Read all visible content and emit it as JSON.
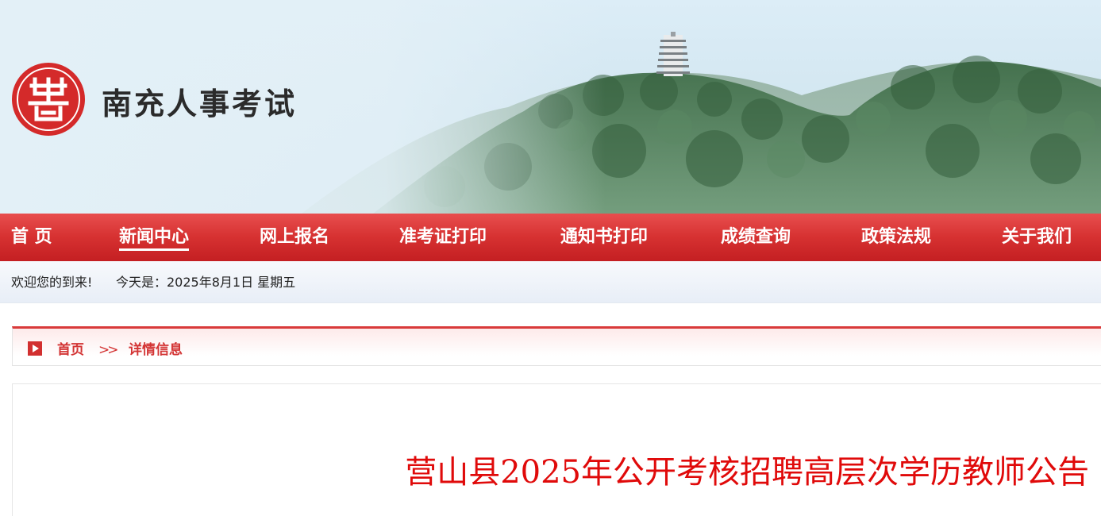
{
  "header": {
    "site_title": "南充人事考试",
    "logo_icon": "seal-logo-icon",
    "brand_color": "#d42a2a"
  },
  "nav": {
    "items": [
      {
        "label": "首 页"
      },
      {
        "label": "新闻中心",
        "active": true
      },
      {
        "label": "网上报名"
      },
      {
        "label": "准考证打印"
      },
      {
        "label": "通知书打印"
      },
      {
        "label": "成绩查询"
      },
      {
        "label": "政策法规"
      },
      {
        "label": "关于我们"
      }
    ]
  },
  "welcome": {
    "greeting": "欢迎您的到来!",
    "today": "今天是：2025年8月1日 星期五"
  },
  "breadcrumb": {
    "icon": "play-arrow-icon",
    "home": "首页",
    "separator": ">>",
    "current": "详情信息"
  },
  "article": {
    "title": "营山县2025年公开考核招聘高层次学历教师公告",
    "title_color": "#e00a0a"
  }
}
